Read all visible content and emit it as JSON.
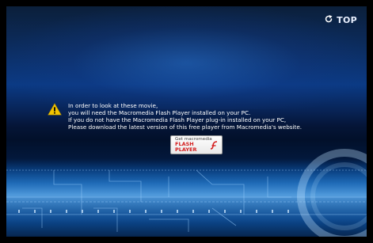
{
  "top_button": {
    "label": "TOP",
    "icon": "refresh-arrow-icon"
  },
  "notice": {
    "icon": "warning-icon",
    "lines": [
      "In order to look at these movie,",
      "you will need the Macromedia Flash Player installed on your PC.",
      "If you do not have the Macromedia Flash Player plug-in installed on your PC,",
      "Please download the latest version of this free player from Macromedia's website."
    ]
  },
  "flash_button": {
    "small_text": "Get macromedia",
    "big_text_1": "FLASH",
    "big_text_2": "PLAYER"
  },
  "colors": {
    "warning": "#f2c400",
    "flash_red": "#d41d1d",
    "bg_blue": "#0b3a84"
  }
}
